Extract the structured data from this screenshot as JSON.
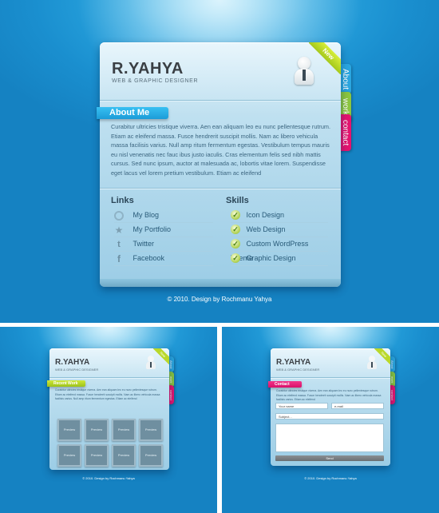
{
  "brand": {
    "name": "R.YAHYA",
    "tagline": "WEB & GRAPHIC DESIGNER",
    "new_badge": "New"
  },
  "tabs": [
    "About",
    "work",
    "contact"
  ],
  "tab_colors": [
    "#2aa6e0",
    "#8cc63f",
    "#e5136f"
  ],
  "about": {
    "title": "About Me",
    "text": "Curabitur ultricies tristique viverra. Aen ean aliquam leo eu nunc pellentesque rutrum. Etiam ac eleifend massa. Fusce hendrerit suscipit mollis. Nam ac libero vehicula massa facilisis varius. Null amp ritum fermentum egestas. Vestibulum tempus mauris eu nisl venenatis nec fauc ibus justo iaculis. Cras elementum felis sed nibh mattis cursus. Sed nunc ipsum, auctor at malesuada ac, lobortis vitae lorem. Suspendisse eget lacus vel lorem pretium vestibulum. Etiam ac eleifend"
  },
  "links": {
    "title": "Links",
    "items": [
      {
        "label": "My Blog",
        "icon": "blog-icon"
      },
      {
        "label": "My Portfolio",
        "icon": "star-icon"
      },
      {
        "label": "Twitter",
        "icon": "twitter-icon"
      },
      {
        "label": "Facebook",
        "icon": "facebook-icon"
      }
    ]
  },
  "skills": {
    "title": "Skills",
    "items": [
      "Icon Design",
      "Web Design",
      "Custom WordPress Theme",
      "Graphic Design"
    ]
  },
  "footer": "© 2010. Design by Rochmanu Yahya",
  "work_page": {
    "ribbon": "Recent Work",
    "intro": "Curabitur ultricies tristique viverra. Aen ean aliquam leo eu nunc pellentesque rutrum. Etiam ac eleifend massa. Fusce hendrerit suscipit mollis. Nam ac libero vehicula massa facilisis varius. Null amp ritum fermentum egestas. Etiam ac eleifend",
    "thumbs": [
      "Preview",
      "Preview",
      "Preview",
      "Preview",
      "Preview",
      "Preview",
      "Preview",
      "Preview"
    ]
  },
  "contact_page": {
    "ribbon": "Contact",
    "intro": "Curabitur ultricies tristique viverra. Aen ean aliquam leo eu nunc pellentesque rutrum. Etiam ac eleifend massa. Fusce hendrerit suscipit mollis. Nam ac libero vehicula massa facilisis varius. Etiam ac eleifend",
    "name_placeholder": "Your name",
    "email_placeholder": "e-mail",
    "subject_placeholder": "Subject...",
    "send_label": "Send"
  }
}
